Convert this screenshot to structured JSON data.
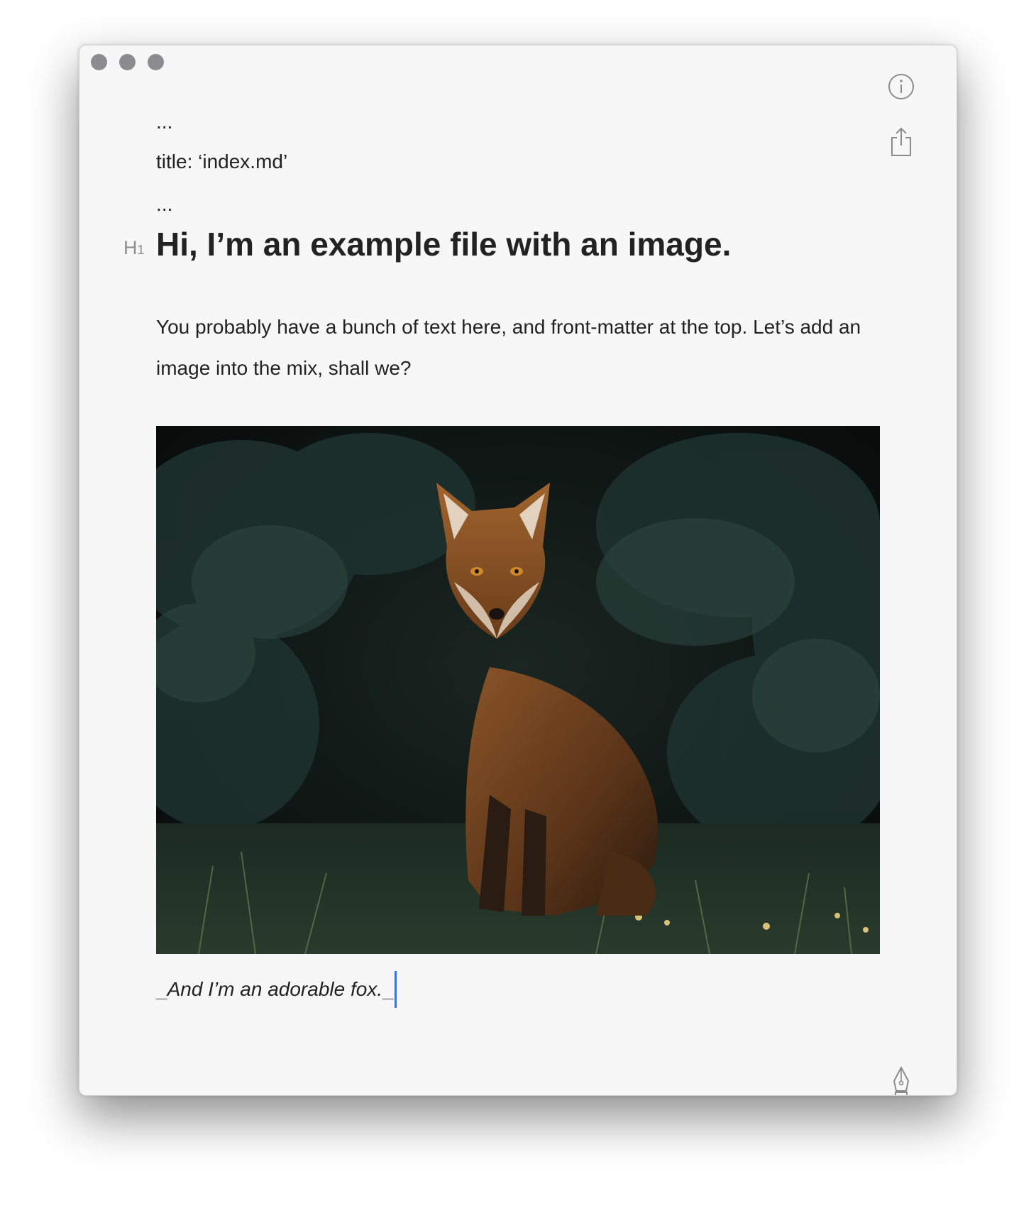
{
  "window": {
    "controls": [
      "close",
      "minimize",
      "zoom"
    ]
  },
  "toolbar": {
    "info_icon": "info-icon",
    "share_icon": "share-icon",
    "pen_icon": "pen-nib-icon"
  },
  "document": {
    "frontmatter_open": "...",
    "frontmatter_title": "title: ‘index.md’",
    "frontmatter_close": "...",
    "heading_marker": "H",
    "heading_marker_level": "1",
    "heading": "Hi, I’m an example file with an image.",
    "paragraph": "You probably have a bunch of text here, and front-matter at the top. Let’s add an image into the mix, shall we?",
    "caption_prefix": "_",
    "caption": "And I’m an adorable fox.",
    "caption_suffix": "_"
  },
  "colors": {
    "window_bg": "#f7f7f7",
    "text": "#222222",
    "marker": "#8e8e8e",
    "caret": "#3d73d6",
    "traffic_dot": "#8c8c8e"
  }
}
